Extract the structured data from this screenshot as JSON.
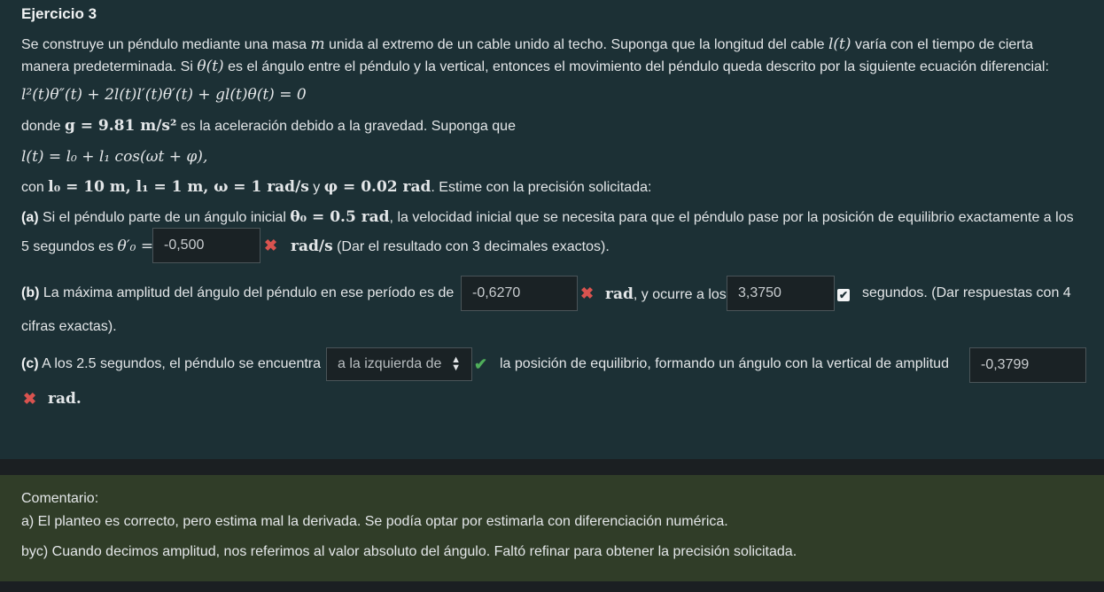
{
  "exercise": {
    "title": "Ejercicio 3",
    "intro_line1_a": "Se construye un péndulo mediante una masa ",
    "intro_line1_m": "m",
    "intro_line1_b": " unida al extremo de un cable unido al techo. Suponga que la longitud del cable ",
    "intro_line1_l": "l(t)",
    "intro_line1_c": " varía con el tiempo de cierta",
    "intro_line2_a": "manera predeterminada. Si ",
    "intro_line2_theta": "θ(t)",
    "intro_line2_b": " es el ángulo entre el péndulo y la vertical, entonces el movimiento del péndulo queda descrito por la siguiente ecuación diferencial:",
    "ode": "l²(t)θ″(t) + 2l(t)l′(t)θ′(t) + gl(t)θ(t) = 0",
    "gravity_a": "donde ",
    "gravity_eq": "g = 9.81 m/s²",
    "gravity_b": " es la aceleración debido a la gravedad. Suponga que",
    "length_eq": "l(t) = l₀ + l₁ cos(ωt + φ),",
    "params_a": "con ",
    "params_eq1": "l₀ = 10 m, l₁ = 1 m, ω = 1 rad/s",
    "params_y": " y ",
    "params_eq2": "φ = 0.02 rad",
    "params_b": ". Estime con la precisión solicitada:"
  },
  "part_a": {
    "label": "(a)",
    "text1_a": " Si el péndulo parte de un ángulo inicial ",
    "text1_eq": "θ₀ = 0.5 rad",
    "text1_b": ", la velocidad inicial que se necesita para que el péndulo pase por la posición de equilibrio exactamente a los",
    "text2": "5 segundos es ",
    "text2_eq": "θ′₀ =",
    "answer": "-0,500",
    "unit": "rad/s",
    "note": " (Dar el resultado con 3 decimales exactos)."
  },
  "part_b": {
    "label": "(b)",
    "text1": " La máxima amplitud del ángulo del péndulo en ese período es de",
    "answer1": "-0,6270",
    "unit1": "rad",
    "text2": ", y ocurre a los",
    "answer2": "3,3750",
    "text3": "segundos. (Dar respuestas con 4",
    "text4": "cifras exactas)."
  },
  "part_c": {
    "label": "(c)",
    "text1": " A los 2.5 segundos, el péndulo se encuentra",
    "select_value": "a la izquierda de",
    "text2": "la posición de equilibrio, formando un ángulo con la vertical de amplitud",
    "answer": "-0,3799",
    "unit": "rad."
  },
  "feedback": {
    "heading": "Comentario:",
    "line1": "a) El planteo es correcto, pero estima mal la derivada. Se podía optar por estimarla con diferenciación numérica.",
    "line2": "byc) Cuando decimos amplitud, nos referimos al valor absoluto del ángulo. Faltó refinar para obtener la precisión solicitada."
  },
  "icons": {
    "incorrect": "x-mark-icon",
    "correct": "check-icon",
    "correct_box": "checkbox-check-icon",
    "select_arrow": "updown-chevron-icon"
  },
  "colors": {
    "panel_bg": "#1c3035",
    "comment_bg": "#303d28",
    "incorrect": "#d9534f",
    "correct": "#4fae5a"
  }
}
